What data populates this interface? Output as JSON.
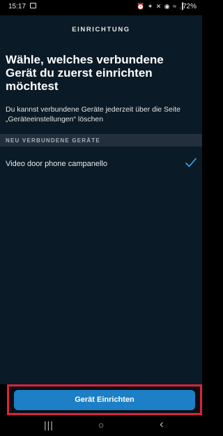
{
  "status_bar": {
    "time": "15:17",
    "icons_text": "⏰ ✶ ✕ ◉ ≈ .▎",
    "battery": "72%"
  },
  "header": {
    "title": "EINRICHTUNG"
  },
  "main": {
    "heading": "Wähle, welches verbundene Gerät du zuerst einrichten möchtest",
    "subtitle": "Du kannst verbundene Geräte jederzeit über die Seite „Geräteeinstellungen“ löschen",
    "section_label": "NEU VERBUNDENE GERÄTE",
    "devices": [
      {
        "name": "Video door phone campanello",
        "selected": true
      }
    ]
  },
  "footer": {
    "button_label": "Gerät Einrichten"
  },
  "nav_bar": {
    "recents": "|||",
    "home": "○",
    "back": "‹"
  },
  "colors": {
    "background": "#0a1a26",
    "section_header_bg": "#232f3c",
    "accent": "#1d7fc5",
    "check": "#39a9e8",
    "highlight_border": "#e0213c"
  },
  "icons": {
    "check": "checkmark-icon",
    "gallery": "gallery-icon"
  }
}
